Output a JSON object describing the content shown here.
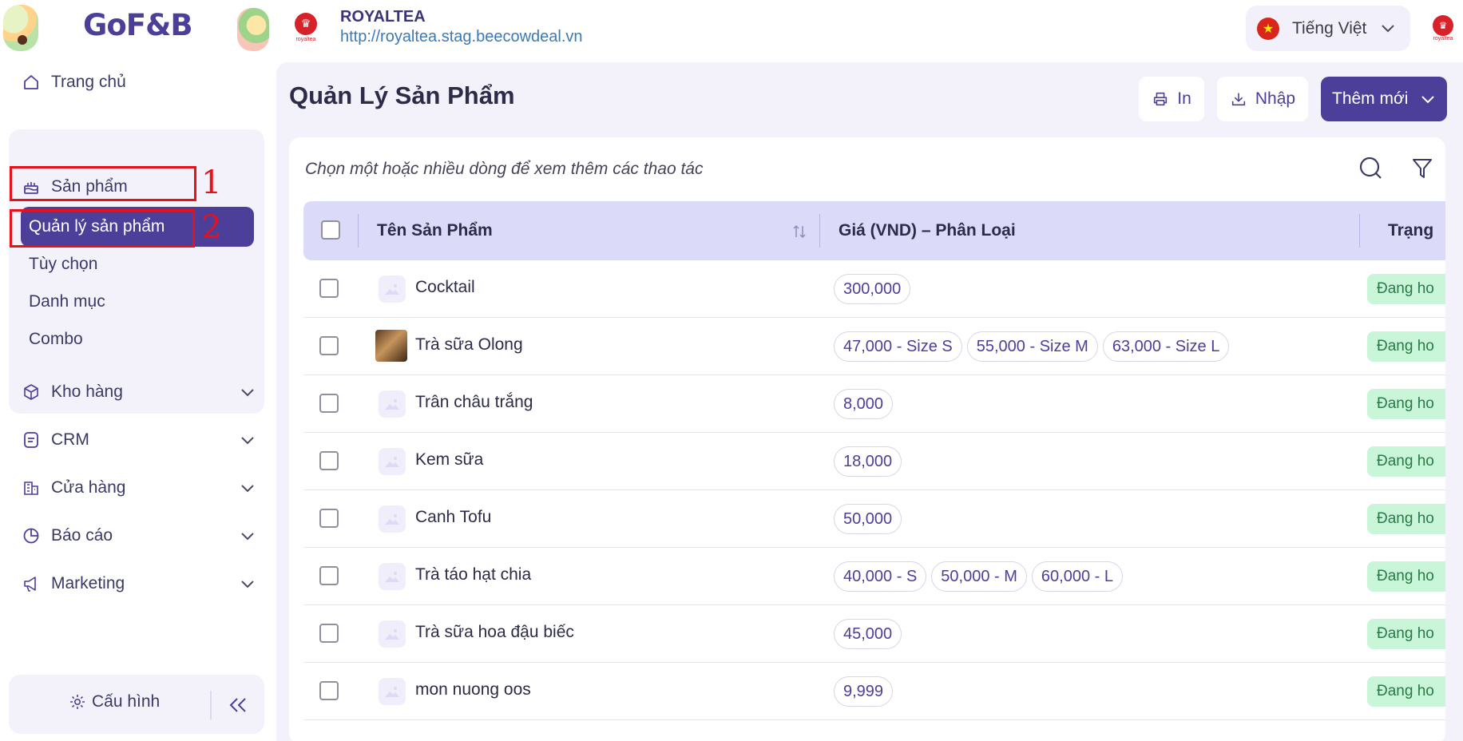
{
  "brand": {
    "logo_text": "GoF&B"
  },
  "store": {
    "logo_caption": "royaltea",
    "name": "ROYALTEA",
    "url": "http://royaltea.stag.beecowdeal.vn"
  },
  "language": {
    "label": "Tiếng Việt"
  },
  "sidebar": {
    "home": "Trang chủ",
    "products": "Sản phẩm",
    "product_sub": [
      "Quản lý sản phẩm",
      "Tùy chọn",
      "Danh mục",
      "Combo"
    ],
    "groups": [
      "Kho hàng",
      "CRM",
      "Cửa hàng",
      "Báo cáo",
      "Marketing"
    ],
    "config": "Cấu hình",
    "annotations": [
      "1",
      "2"
    ]
  },
  "page": {
    "title": "Quản Lý Sản Phẩm",
    "print_label": "In",
    "import_label": "Nhập",
    "add_label": "Thêm mới",
    "hint": "Chọn một hoặc nhiều dòng để xem thêm các thao tác"
  },
  "table": {
    "columns": [
      "Tên Sản Phẩm",
      "Giá (VND) – Phân Loại",
      "Trạng"
    ],
    "rows": [
      {
        "name": "Cocktail",
        "prices": [
          "300,000"
        ],
        "status": "Đang ho",
        "photo": false
      },
      {
        "name": "Trà sữa Olong",
        "prices": [
          "47,000 - Size S",
          "55,000 - Size M",
          "63,000 - Size L"
        ],
        "status": "Đang ho",
        "photo": true
      },
      {
        "name": "Trân châu trắng",
        "prices": [
          "8,000"
        ],
        "status": "Đang ho",
        "photo": false
      },
      {
        "name": "Kem sữa",
        "prices": [
          "18,000"
        ],
        "status": "Đang ho",
        "photo": false
      },
      {
        "name": "Canh Tofu",
        "prices": [
          "50,000"
        ],
        "status": "Đang ho",
        "photo": false
      },
      {
        "name": "Trà táo hạt chia",
        "prices": [
          "40,000 - S",
          "50,000 - M",
          "60,000 - L"
        ],
        "status": "Đang ho",
        "photo": false
      },
      {
        "name": "Trà sữa hoa đậu biếc",
        "prices": [
          "45,000"
        ],
        "status": "Đang ho",
        "photo": false
      },
      {
        "name": "mon nuong oos",
        "prices": [
          "9,999"
        ],
        "status": "Đang ho",
        "photo": false
      }
    ]
  },
  "colors": {
    "primary": "#4b3f9a",
    "header_bg": "#dcdaf9",
    "status_bg": "#c9f5d8",
    "annotation": "#e4131b"
  }
}
